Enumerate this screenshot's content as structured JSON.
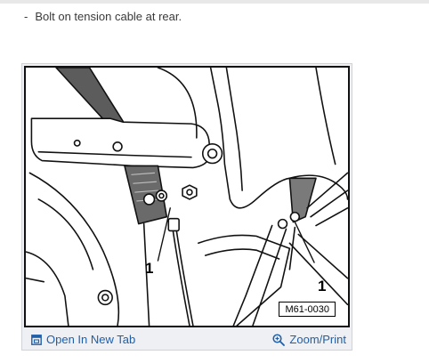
{
  "step": {
    "bullet": "-",
    "text": "Bolt on tension cable at rear."
  },
  "figure": {
    "callout_left": "1",
    "callout_right": "1",
    "code": "M61-0030"
  },
  "toolbar": {
    "open_tab_label": "Open In New Tab",
    "zoom_label": "Zoom/Print",
    "link_color": "#1f5fa8"
  }
}
